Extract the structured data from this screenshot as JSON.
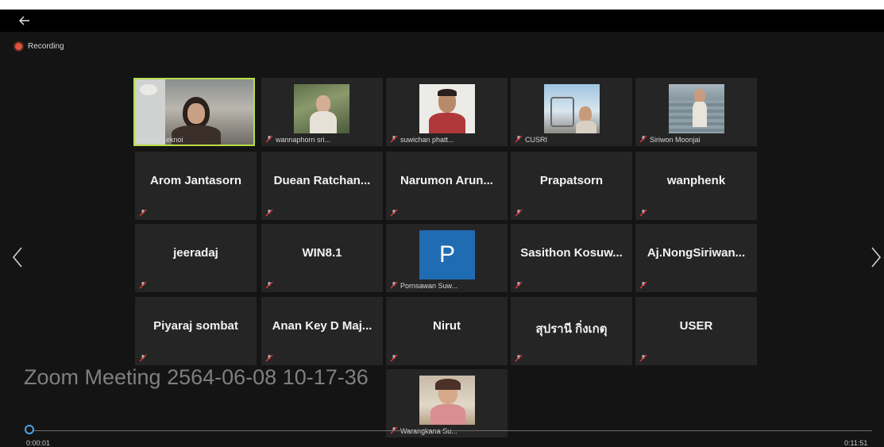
{
  "recording_label": "Recording",
  "meeting_title": "Zoom Meeting 2564-06-08 10-17-36",
  "time_current": "0:00:01",
  "time_total": "0:11:51",
  "progress": 0.0014,
  "colors": {
    "active_border": "#b9dc4a",
    "recording": "#e0533a",
    "seek_accent": "#4aa3e8",
    "avatar_bg": "#1f6cb3"
  },
  "icons": {
    "back": "arrow-left-icon",
    "prev": "chevron-left-icon",
    "next": "chevron-right-icon",
    "mic": "mic-muted-icon"
  },
  "participants": [
    {
      "label": "Unruan Leknoi",
      "video": true
    },
    {
      "label": "wannaphorn sri...",
      "video": true
    },
    {
      "label": "suwichan phatt...",
      "video": true
    },
    {
      "label": "CUSRI",
      "video": true
    },
    {
      "label": "Siriwon Moonjai",
      "video": true
    },
    {
      "name": "Arom Jantasorn"
    },
    {
      "name": "Duean Ratchan..."
    },
    {
      "name": "Narumon Arun..."
    },
    {
      "name": "Prapatsorn"
    },
    {
      "name": "wanphenk"
    },
    {
      "name": "jeeradaj"
    },
    {
      "name": "WIN8.1"
    },
    {
      "label": "Pornsawan Suw...",
      "avatar_letter": "P"
    },
    {
      "name": "Sasithon Kosuw..."
    },
    {
      "name": "Aj.NongSiriwan..."
    },
    {
      "name": "Piyaraj sombat"
    },
    {
      "name": "Anan Key D Maj..."
    },
    {
      "name": "Nirut"
    },
    {
      "name": "สุปรานี กิ่งเกตุ"
    },
    {
      "name": "USER"
    },
    {
      "label": "Warangkana Su...",
      "video": true
    }
  ]
}
